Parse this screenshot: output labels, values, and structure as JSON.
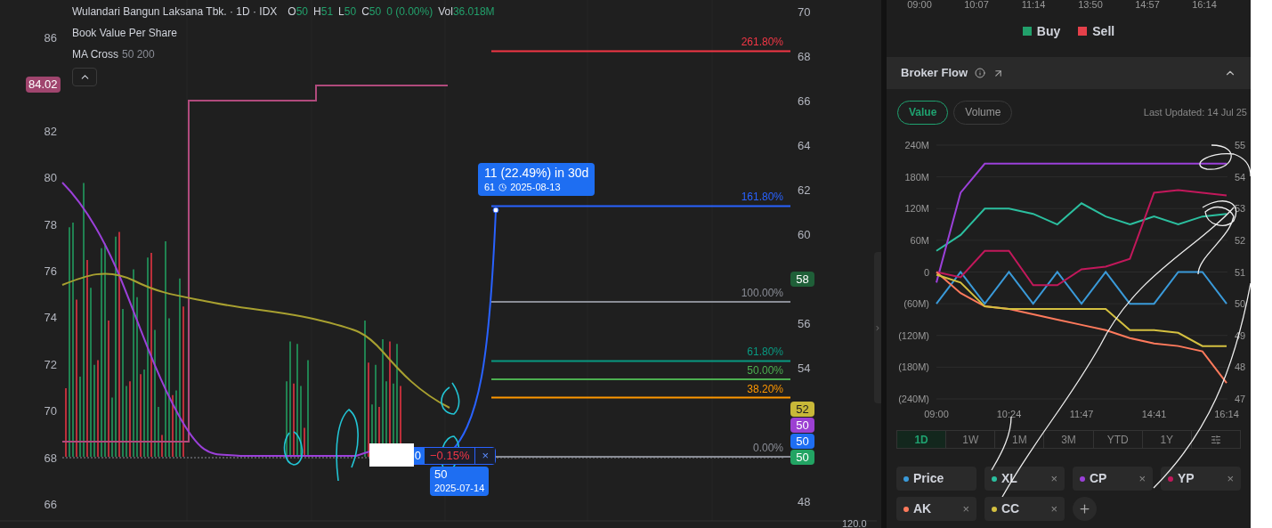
{
  "main_chart": {
    "legend": {
      "symbol": "Wulandari Bangun Laksana Tbk. · 1D · IDX",
      "ohlc": [
        {
          "label": "O",
          "value": "50"
        },
        {
          "label": "H",
          "value": "51"
        },
        {
          "label": "L",
          "value": "50"
        },
        {
          "label": "C",
          "value": "50"
        }
      ],
      "change": "0 (0.00%)",
      "volume_label": "Vol",
      "volume": "36.018M",
      "indicators": [
        {
          "name": "Book Value Per Share"
        },
        {
          "name": "MA Cross",
          "params": "50 200"
        }
      ],
      "expanded": true
    },
    "left_axis": [
      "86",
      "82",
      "80",
      "78",
      "76",
      "74",
      "72",
      "70",
      "68",
      "66"
    ],
    "right_axis": [
      "70",
      "68",
      "66",
      "64",
      "62",
      "60",
      "56",
      "54",
      "48"
    ],
    "left_tag": {
      "text": "84.02",
      "color": "#a0456e"
    },
    "right_tags": [
      {
        "text": "58",
        "color": "#1f5f38"
      },
      {
        "text": "52",
        "color": "#c8b838"
      },
      {
        "text": "50",
        "color": "#9c40d2"
      },
      {
        "text": "50",
        "color": "#1e6ef2"
      },
      {
        "text": "50",
        "color": "#22a463"
      }
    ],
    "fib_levels": [
      {
        "label": "261.80%",
        "color": "#f23645"
      },
      {
        "label": "161.80%",
        "color": "#2962ff"
      },
      {
        "label": "100.00%",
        "color": "#8a8d96"
      },
      {
        "label": "61.80%",
        "color": "#089981"
      },
      {
        "label": "50.00%",
        "color": "#4caf50"
      },
      {
        "label": "38.20%",
        "color": "#ff9800"
      },
      {
        "label": "0.00%",
        "color": "#8a8d96"
      }
    ],
    "measure": {
      "change": "11 (22.49%) in 30d",
      "target": "61",
      "target_date": "2025-08-13",
      "start_price": "50",
      "start_date": "2025-07-14",
      "pill_value": "0",
      "pill_change": "−0.15%",
      "close": "×"
    },
    "bottom_axis_label": "120.0"
  },
  "broker_panel": {
    "top_axis": [
      "09:00",
      "10:07",
      "11:14",
      "13:50",
      "14:57",
      "16:14"
    ],
    "legend": [
      {
        "label": "Buy",
        "color": "#22a06b"
      },
      {
        "label": "Sell",
        "color": "#e5404a"
      }
    ],
    "title": "Broker Flow",
    "expanded": true,
    "modes": [
      {
        "label": "Value",
        "selected": true
      },
      {
        "label": "Volume",
        "selected": false
      }
    ],
    "last_updated": "Last Updated: 14 Jul 25",
    "chart_data": {
      "type": "line",
      "categories": [
        "09:00",
        null,
        null,
        "10:24",
        null,
        null,
        "11:47",
        null,
        null,
        "14:41",
        null,
        null,
        "16:14"
      ],
      "ylim": [
        -240,
        240
      ],
      "grid": true,
      "y2lim": [
        47,
        55
      ],
      "y2ticks": [
        55,
        54,
        53,
        52,
        51,
        50,
        49,
        48,
        47
      ],
      "yticks": [
        {
          "value": 240,
          "label": "240M"
        },
        {
          "value": 180,
          "label": "180M"
        },
        {
          "value": 120,
          "label": "120M"
        },
        {
          "value": 60,
          "label": "60M"
        },
        {
          "value": 0,
          "label": "0"
        },
        {
          "value": -60,
          "label": "(60M)"
        },
        {
          "value": -120,
          "label": "(120M)"
        },
        {
          "value": -180,
          "label": "(180M)"
        },
        {
          "value": -240,
          "label": "(240M)"
        }
      ],
      "series": [
        {
          "name": "Price",
          "color": "#3a9ad9",
          "axis": "y2",
          "values": [
            50,
            51,
            50,
            51,
            50,
            51,
            50,
            51,
            50,
            50,
            51,
            51,
            50
          ]
        },
        {
          "name": "XL",
          "color": "#2bbf9f",
          "values": [
            40,
            70,
            120,
            120,
            110,
            90,
            130,
            105,
            90,
            105,
            90,
            105,
            110
          ]
        },
        {
          "name": "CP",
          "color": "#9b40d9",
          "values": [
            -20,
            150,
            205,
            205,
            205,
            205,
            205,
            205,
            205,
            205,
            205,
            205,
            205
          ]
        },
        {
          "name": "YP",
          "color": "#c2185b",
          "values": [
            0,
            -10,
            40,
            40,
            -25,
            -25,
            5,
            10,
            25,
            150,
            155,
            150,
            145
          ]
        },
        {
          "name": "AK",
          "color": "#ff7a5c",
          "values": [
            0,
            -40,
            -65,
            -70,
            -80,
            -90,
            -100,
            -110,
            -125,
            -135,
            -140,
            -150,
            -210
          ]
        },
        {
          "name": "CC",
          "color": "#d4c040",
          "values": [
            -5,
            -20,
            -65,
            -70,
            -70,
            -70,
            -70,
            -70,
            -110,
            -110,
            -115,
            -140,
            -140
          ]
        }
      ]
    },
    "periods": [
      {
        "label": "1D",
        "selected": true
      },
      {
        "label": "1W",
        "selected": false
      },
      {
        "label": "1M",
        "selected": false
      },
      {
        "label": "3M",
        "selected": false
      },
      {
        "label": "YTD",
        "selected": false
      },
      {
        "label": "1Y",
        "selected": false
      }
    ],
    "brokers": [
      {
        "removable": false
      },
      {
        "removable": true
      },
      {
        "removable": true
      },
      {
        "removable": true
      },
      {
        "removable": true
      },
      {
        "removable": true
      }
    ],
    "remove_glyph": "×"
  }
}
